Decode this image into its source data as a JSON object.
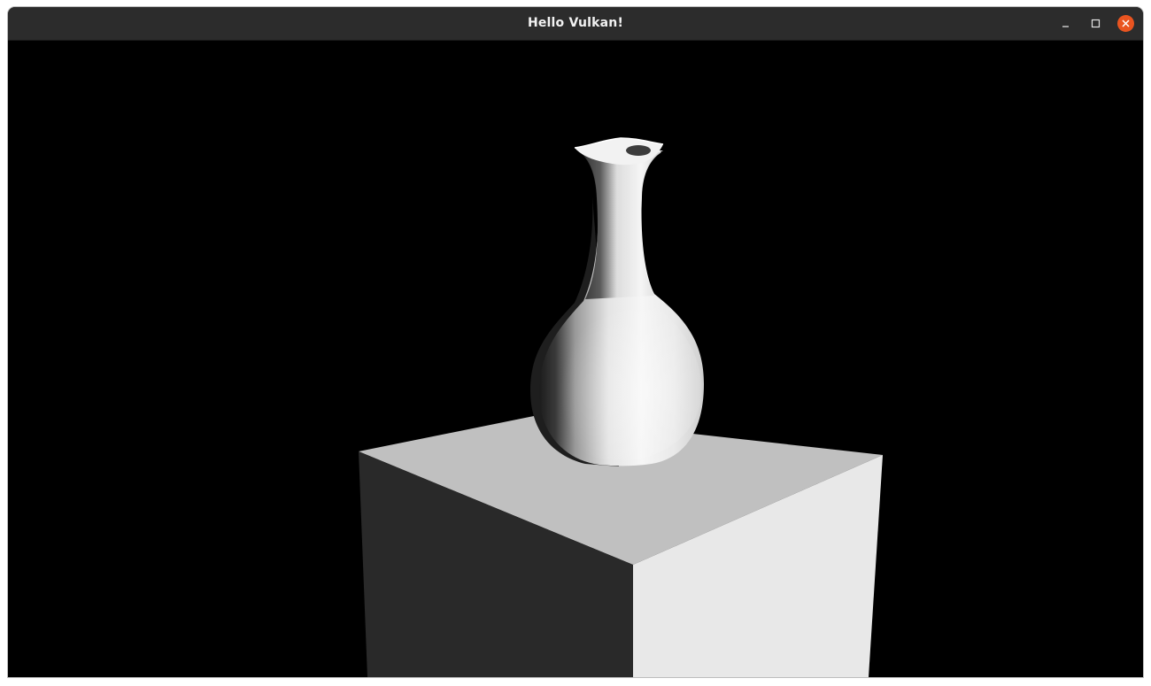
{
  "window": {
    "title": "Hello Vulkan!",
    "controls": [
      "minimize-icon",
      "maximize-icon",
      "close-icon"
    ],
    "colors": {
      "titlebar": "#2c2c2c",
      "title_text": "#f2f2f2",
      "close_button": "#e95420",
      "viewport_background": "#000000"
    }
  },
  "scene": {
    "objects": [
      "vase",
      "pedestal"
    ],
    "colors": {
      "pedestal_top": "#c0c0c0",
      "pedestal_left": "#292929",
      "pedestal_right": "#e8e8e8"
    }
  }
}
